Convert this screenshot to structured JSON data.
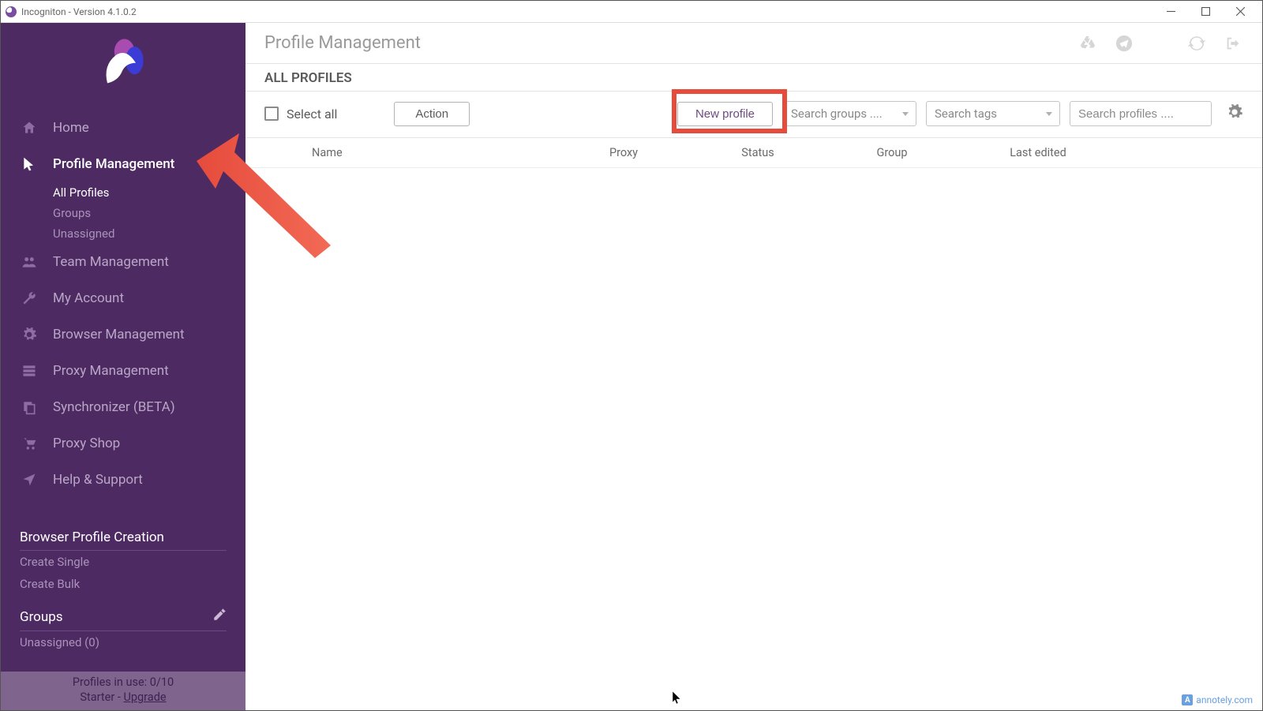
{
  "window": {
    "title": "Incogniton - Version 4.1.0.2"
  },
  "sidebar": {
    "nav": [
      {
        "label": "Home"
      },
      {
        "label": "Profile Management"
      },
      {
        "label": "Team Management"
      },
      {
        "label": "My Account"
      },
      {
        "label": "Browser Management"
      },
      {
        "label": "Proxy Management"
      },
      {
        "label": "Synchronizer (BETA)"
      },
      {
        "label": "Proxy Shop"
      },
      {
        "label": "Help & Support"
      }
    ],
    "profile_sub": [
      {
        "label": "All Profiles"
      },
      {
        "label": "Groups"
      },
      {
        "label": "Unassigned"
      }
    ],
    "section_creation_title": "Browser Profile Creation",
    "creation_links": [
      {
        "label": "Create Single"
      },
      {
        "label": "Create Bulk"
      }
    ],
    "section_groups_title": "Groups",
    "groups_links": [
      {
        "label": "Unassigned (0)"
      }
    ],
    "footer_line1": "Profiles in use:  0/10",
    "footer_line2_prefix": "Starter - ",
    "footer_upgrade": "Upgrade"
  },
  "header": {
    "title": "Profile Management"
  },
  "subheading": "ALL PROFILES",
  "toolbar": {
    "select_all": "Select all",
    "action": "Action",
    "new_profile": "New profile",
    "search_groups_placeholder": "Search groups ....",
    "search_tags_placeholder": "Search tags",
    "search_profiles_placeholder": "Search profiles ...."
  },
  "columns": {
    "name": "Name",
    "proxy": "Proxy",
    "status": "Status",
    "group": "Group",
    "last_edited": "Last edited"
  },
  "watermark": "annotely.com"
}
